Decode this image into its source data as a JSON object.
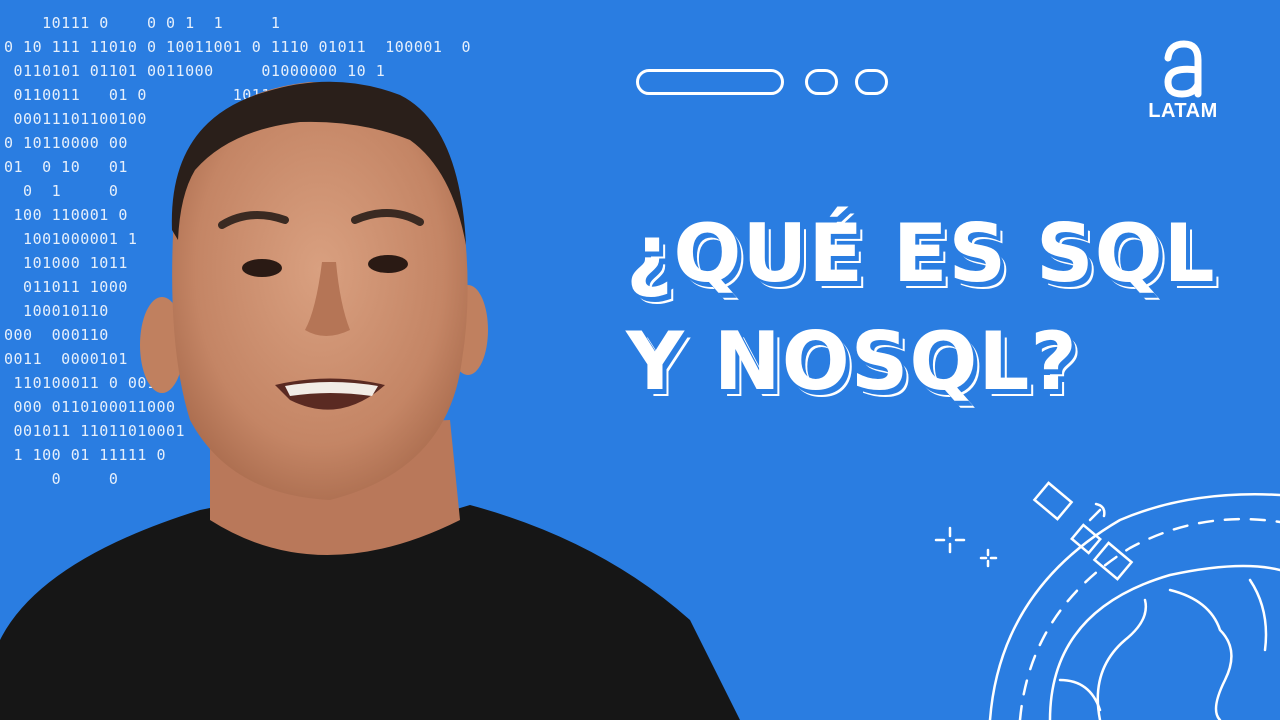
{
  "headline": {
    "line1": "¿QUÉ ES SQL",
    "line2": "Y NOSQL?"
  },
  "logo": {
    "text": "LATAM",
    "icon": "a-logo-icon"
  },
  "binary_lines": [
    "    10111 0    0 0 1  1     1",
    "0 10 111 11010 0 10011001 0 1110 01011  100001  0",
    " 0110101 01101 0011000     01000000 10 1",
    " 0110011   01 0         10110   10100",
    " 00011101100100            000 0",
    "0 10110000 00        1 111010 1",
    "01  0 10   01         11011  0",
    "  0  1     0      1   11 0   0  1",
    " 100 110001 0          110",
    "  1001000001 1         0001",
    "  101000 1011          0  0",
    "  011011 1000          0",
    "  100010110            0 0110",
    "000  000110            1101",
    "0011  0000101          01",
    " 110100011 0 001       1100",
    " 000 0110100011000     10100",
    " 001011 11011010001    111011",
    " 1 100 01 11111 0      11000",
    "     0     0"
  ],
  "colors": {
    "background": "#2a7de1",
    "foreground": "#ffffff",
    "shirt": "#161616",
    "skin": "#c98e6e"
  }
}
